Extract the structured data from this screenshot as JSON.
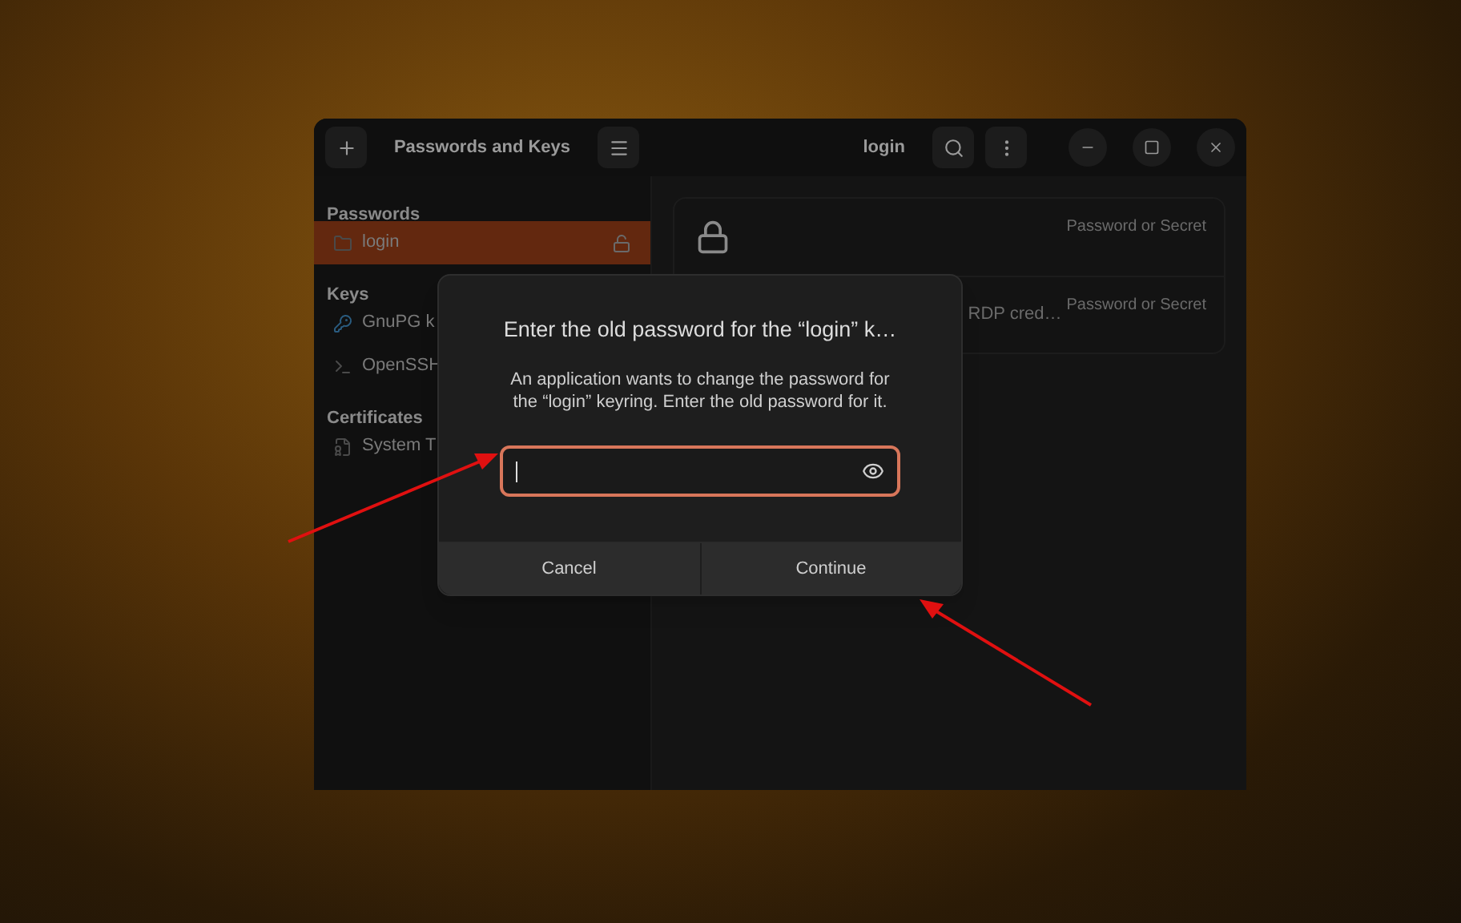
{
  "window": {
    "title": "Passwords and Keys",
    "subtitle": "login"
  },
  "sidebar": {
    "sections": [
      {
        "heading": "Passwords",
        "items": [
          {
            "label": "login",
            "kind": "keyring",
            "selected": true,
            "locked": false
          }
        ]
      },
      {
        "heading": "Keys",
        "items": [
          {
            "label": "GnuPG k",
            "kind": "gpg",
            "selected": false
          },
          {
            "label": "OpenSSH",
            "kind": "ssh",
            "selected": false
          }
        ]
      },
      {
        "heading": "Certificates",
        "items": [
          {
            "label": "System T",
            "kind": "cert",
            "selected": false
          }
        ]
      }
    ]
  },
  "items": [
    {
      "type": "Password or Secret"
    },
    {
      "name": "RDP cred…",
      "type": "Password or Secret"
    }
  ],
  "dialog": {
    "title": "Enter the old password for the “login” k…",
    "message": "An application wants to change the password for the “login” keyring. Enter the old password for it.",
    "password": {
      "focused": true
    },
    "buttons": [
      "Cancel",
      "Continue"
    ]
  }
}
